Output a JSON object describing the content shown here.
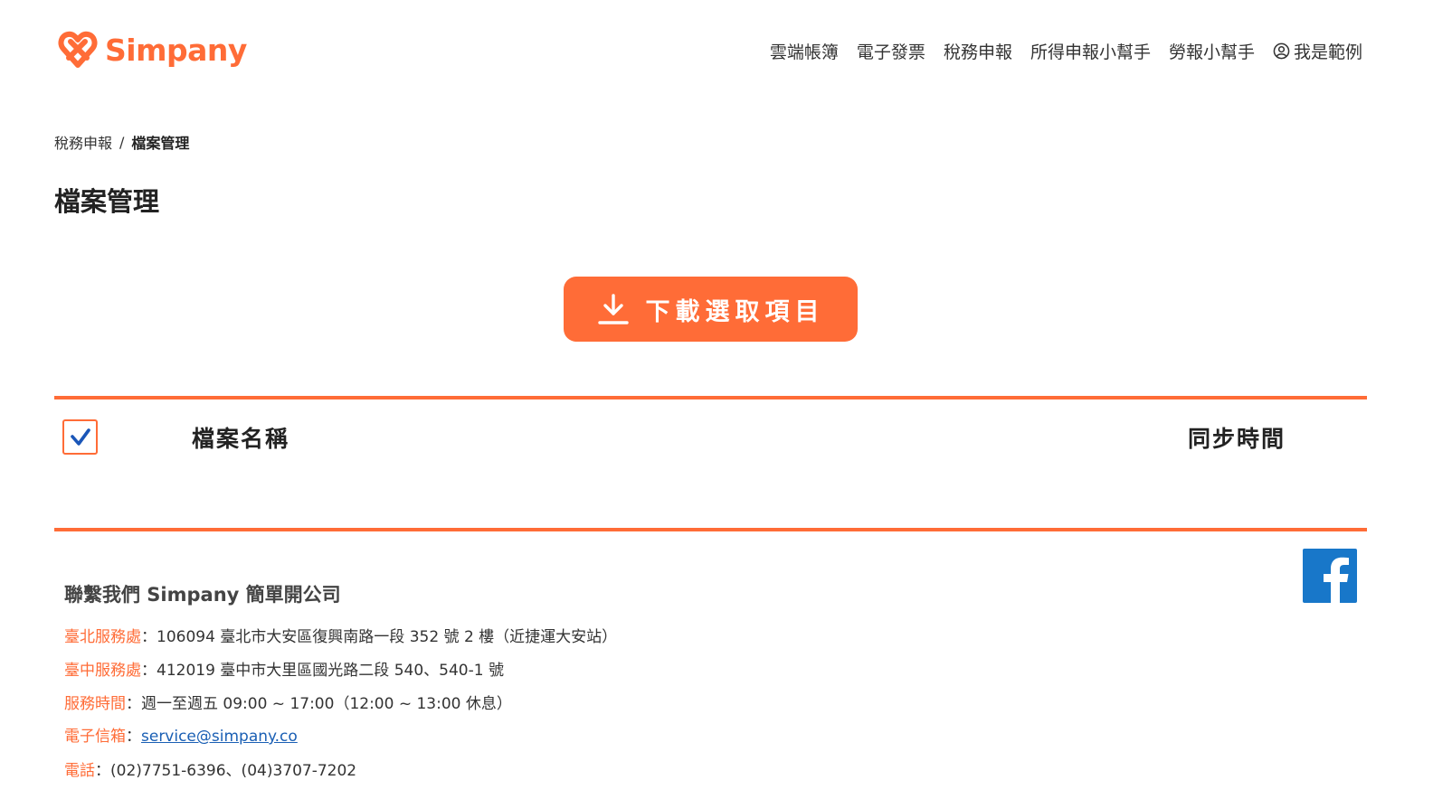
{
  "brand": {
    "name": "Simpany",
    "color": "#ff6c37",
    "logo_icon": "simpany-logo-mark"
  },
  "nav": {
    "items": [
      "雲端帳簿",
      "電子發票",
      "稅務申報",
      "所得申報小幫手",
      "勞報小幫手"
    ],
    "user": {
      "icon": "user-circle-icon",
      "label": "我是範例"
    }
  },
  "breadcrumb": {
    "parent": "稅務申報",
    "separator": "/",
    "current": "檔案管理"
  },
  "page_title": "檔案管理",
  "download_button": {
    "icon": "download-icon",
    "label": "下載選取項目"
  },
  "table": {
    "select_all_checked": true,
    "columns": {
      "name": "檔案名稱",
      "sync_time": "同步時間"
    },
    "rows": []
  },
  "footer": {
    "title": "聯繫我們  Simpany 簡單開公司",
    "facebook_icon": "facebook-icon",
    "taipei": {
      "label": "臺北服務處",
      "sep": "：",
      "value": "106094 臺北市大安區復興南路一段 352 號 2 樓（近捷運大安站）"
    },
    "taichung": {
      "label": "臺中服務處",
      "sep": "：",
      "value": "412019 臺中市大里區國光路二段 540、540-1 號"
    },
    "hours": {
      "label": "服務時間",
      "sep": "：",
      "value": "週一至週五 09:00 ~ 17:00（12:00 ~ 13:00 休息）"
    },
    "email": {
      "label": "電子信箱",
      "sep": "：",
      "value": "service@simpany.co"
    },
    "phone": {
      "label": "電話",
      "sep": "：",
      "value": "(02)7751-6396、(04)3707-7202"
    }
  }
}
